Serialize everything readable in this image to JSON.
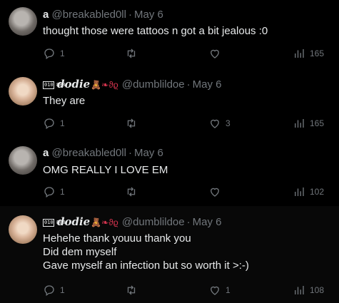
{
  "tweets": [
    {
      "name": "a",
      "handle": "@breakabled0ll",
      "date": "May 6",
      "text": [
        "thought those were tattoos n got a bit jealous :0"
      ],
      "replies": "1",
      "retweets": "",
      "likes": "",
      "views": "165",
      "avatar": "a"
    },
    {
      "name": "dodie",
      "name_suffix": "🧸❧ϑϱ",
      "badge": "010 888",
      "handle": "@dumblildoe",
      "date": "May 6",
      "text": [
        "They are"
      ],
      "replies": "1",
      "retweets": "",
      "likes": "3",
      "views": "165",
      "avatar": "d"
    },
    {
      "name": "a",
      "handle": "@breakabled0ll",
      "date": "May 6",
      "text": [
        "OMG REALLY I LOVE EM"
      ],
      "replies": "1",
      "retweets": "",
      "likes": "",
      "views": "102",
      "avatar": "a"
    },
    {
      "name": "dodie",
      "name_suffix": "🧸❧ϑϱ",
      "badge": "010 888",
      "handle": "@dumblildoe",
      "date": "May 6",
      "text": [
        "Hehehe thank youuu thank you",
        "Did dem myself",
        "Gave myself an infection but so worth it >:-)"
      ],
      "replies": "1",
      "retweets": "",
      "likes": "1",
      "views": "108",
      "avatar": "d"
    }
  ],
  "separator": "·",
  "icons": {
    "reply": "reply-icon",
    "retweet": "retweet-icon",
    "like": "heart-icon",
    "views": "views-bar-chart-icon"
  }
}
